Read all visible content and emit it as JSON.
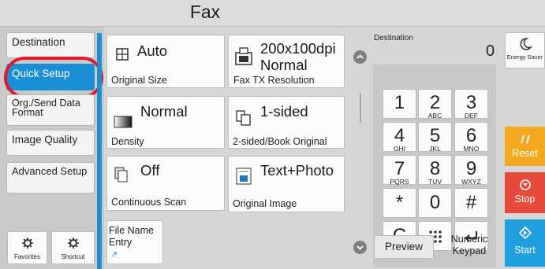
{
  "title": "Fax",
  "nav": [
    {
      "label": "Destination"
    },
    {
      "label": "Quick Setup"
    },
    {
      "label": "Org./Send Data Format"
    },
    {
      "label": "Image Quality"
    },
    {
      "label": "Advanced Setup"
    }
  ],
  "shortcuts": {
    "favorites": "Favorites",
    "shortcut": "Shortcut"
  },
  "tiles": {
    "original_size": {
      "value": "Auto",
      "label": "Original Size"
    },
    "fax_tx_resolution": {
      "value": "200x100dpi Normal",
      "label": "Fax TX Resolution"
    },
    "density": {
      "value": "Normal",
      "label": "Density"
    },
    "two_sided": {
      "value": "1-sided",
      "label": "2-sided/Book Original"
    },
    "continuous_scan": {
      "value": "Off",
      "label": "Continuous Scan"
    },
    "original_image": {
      "value": "Text+Photo",
      "label": "Original Image"
    },
    "file_name_entry": {
      "label": "File Name Entry"
    }
  },
  "destination": {
    "label": "Destination",
    "count": "0"
  },
  "keypad": {
    "keys": [
      {
        "num": "1",
        "sub": ""
      },
      {
        "num": "2",
        "sub": "ABC"
      },
      {
        "num": "3",
        "sub": "DEF"
      },
      {
        "num": "4",
        "sub": "GHI"
      },
      {
        "num": "5",
        "sub": "JKL"
      },
      {
        "num": "6",
        "sub": "MNO"
      },
      {
        "num": "7",
        "sub": "PQRS"
      },
      {
        "num": "8",
        "sub": "TUV"
      },
      {
        "num": "9",
        "sub": "WXYZ"
      },
      {
        "num": "*",
        "sub": ""
      },
      {
        "num": "0",
        "sub": ""
      },
      {
        "num": "#",
        "sub": ""
      }
    ],
    "clear": "C",
    "numeric_keypad_label": "Numeric Keypad"
  },
  "preview": "Preview",
  "side": {
    "energy_saver": "Energy Saver",
    "reset": "Reset",
    "stop": "Stop",
    "start": "Start"
  },
  "colors": {
    "accent": "#1b8fd6",
    "reset": "#f3a81f",
    "stop": "#e64a3a",
    "start": "#1f9fe0",
    "highlight_ring": "#e01b24"
  },
  "icons": [
    "original-size-icon",
    "fax-resolution-icon",
    "density-icon",
    "duplex-icon",
    "continuous-scan-icon",
    "original-image-icon",
    "moon-icon",
    "reset-icon",
    "stop-icon",
    "start-icon",
    "star-gear-icon",
    "shortcut-gear-icon",
    "enter-icon",
    "dots-icon"
  ]
}
